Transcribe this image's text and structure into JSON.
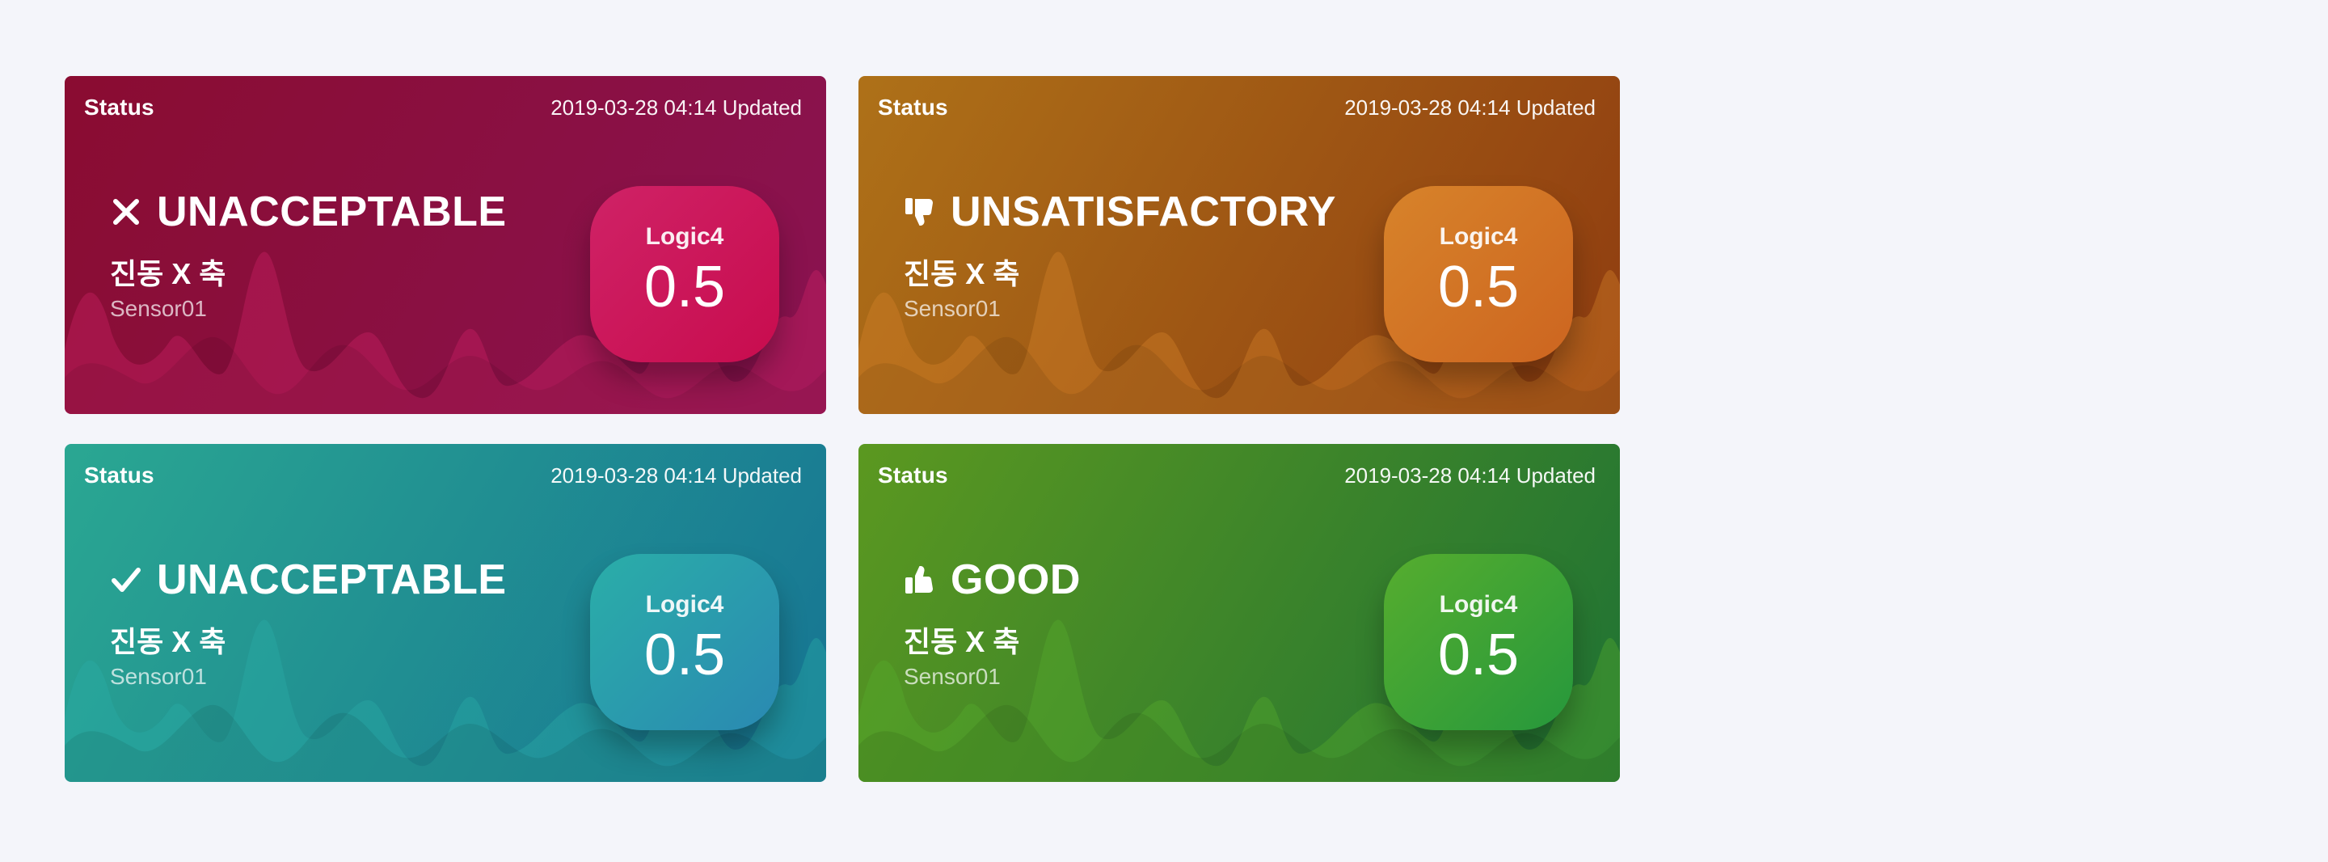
{
  "cards": [
    {
      "title": "Status",
      "updated": "2019-03-28 04:14 Updated",
      "status_icon": "close-icon",
      "status": "UNACCEPTABLE",
      "measure": "진동 X 축",
      "sensor": "Sensor01",
      "logic_label": "Logic4",
      "value": "0.5",
      "colors": {
        "from": "#8a0c31",
        "to": "#8a1352",
        "badge_from": "#cf2266",
        "badge_to": "#c80c4e"
      }
    },
    {
      "title": "Status",
      "updated": "2019-03-28 04:14 Updated",
      "status_icon": "thumbs-down-icon",
      "status": "UNSATISFACTORY",
      "measure": "진동 X 축",
      "sensor": "Sensor01",
      "logic_label": "Logic4",
      "value": "0.5",
      "colors": {
        "from": "#ae7118",
        "to": "#8f3c10",
        "badge_from": "#d7832a",
        "badge_to": "#cd6520"
      }
    },
    {
      "title": "Status",
      "updated": "2019-03-28 04:14 Updated",
      "status_icon": "check-icon",
      "status": "UNACCEPTABLE",
      "measure": "진동 X 축",
      "sensor": "Sensor01",
      "logic_label": "Logic4",
      "value": "0.5",
      "colors": {
        "from": "#2aa792",
        "to": "#167493",
        "badge_from": "#2aaea8",
        "badge_to": "#2a89b2"
      }
    },
    {
      "title": "Status",
      "updated": "2019-03-28 04:14 Updated",
      "status_icon": "thumbs-up-icon",
      "status": "GOOD",
      "measure": "진동 X 축",
      "sensor": "Sensor01",
      "logic_label": "Logic4",
      "value": "0.5",
      "colors": {
        "from": "#5b9820",
        "to": "#1f7234",
        "badge_from": "#56ad2e",
        "badge_to": "#26983c"
      }
    }
  ]
}
